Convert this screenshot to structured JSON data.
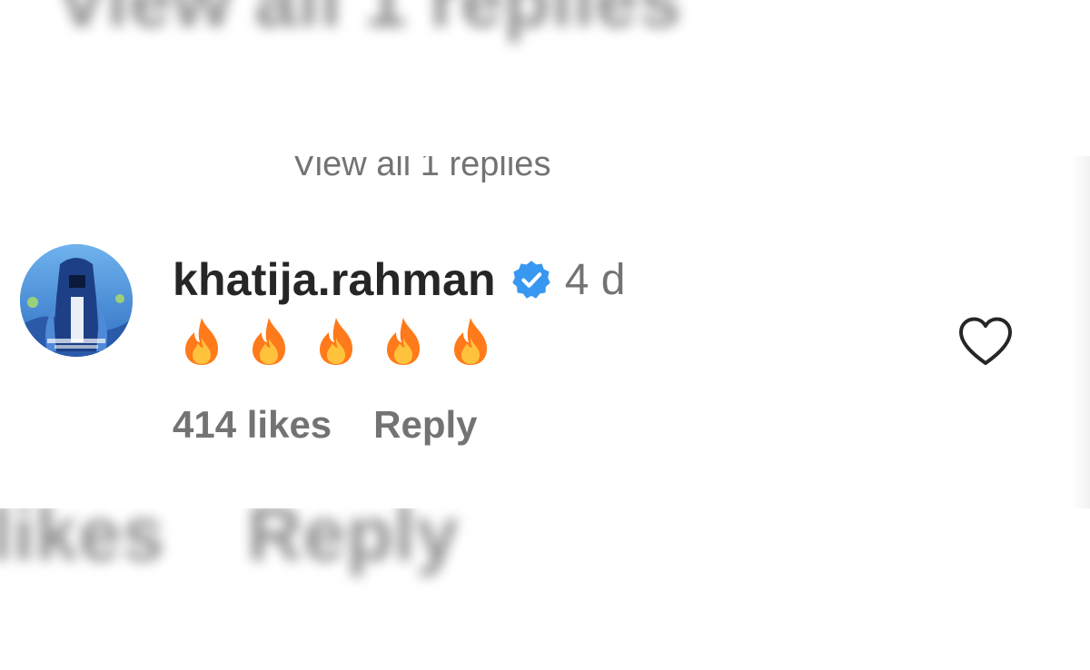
{
  "background": {
    "top_text": "View all 1 replies",
    "bottom_likes": "likes",
    "bottom_reply": "Reply"
  },
  "thread": {
    "view_replies_label": "View all 1 replies"
  },
  "comment": {
    "username": "khatija.rahman",
    "verified": true,
    "time": "4 d",
    "emojis": [
      "fire-emoji",
      "fire-emoji",
      "fire-emoji",
      "fire-emoji",
      "fire-emoji"
    ],
    "likes": "414 likes",
    "reply_label": "Reply",
    "like_icon": "heart-outline-icon"
  },
  "colors": {
    "text_primary": "#262626",
    "text_secondary": "#737373",
    "verified_blue": "#3897f0",
    "background": "#ffffff"
  }
}
